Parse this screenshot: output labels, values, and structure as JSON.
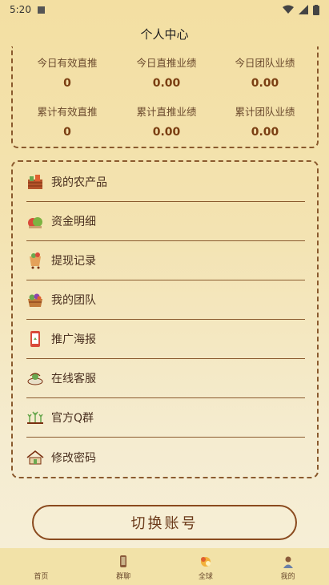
{
  "status_bar": {
    "time": "5:20"
  },
  "header": {
    "title": "个人中心"
  },
  "stats": [
    {
      "label": "今日有效直推",
      "value": "0"
    },
    {
      "label": "今日直推业绩",
      "value": "0.00"
    },
    {
      "label": "今日团队业绩",
      "value": "0.00"
    },
    {
      "label": "累计有效直推",
      "value": "0"
    },
    {
      "label": "累计直推业绩",
      "value": "0.00"
    },
    {
      "label": "累计团队业绩",
      "value": "0.00"
    }
  ],
  "menu": {
    "items": [
      {
        "label": "我的农产品",
        "icon": "farm-produce-icon"
      },
      {
        "label": "资金明细",
        "icon": "funds-icon"
      },
      {
        "label": "提现记录",
        "icon": "withdraw-icon"
      },
      {
        "label": "我的团队",
        "icon": "team-icon"
      },
      {
        "label": "推广海报",
        "icon": "poster-icon"
      },
      {
        "label": "在线客服",
        "icon": "customer-service-icon"
      },
      {
        "label": "官方Q群",
        "icon": "qq-group-icon"
      },
      {
        "label": "修改密码",
        "icon": "password-icon"
      }
    ]
  },
  "switch_account": {
    "label": "切换账号"
  },
  "tabs": [
    {
      "label": "首页",
      "icon": "home-icon"
    },
    {
      "label": "群聊",
      "icon": "chat-icon"
    },
    {
      "label": "全球",
      "icon": "global-icon"
    },
    {
      "label": "我的",
      "icon": "profile-icon"
    }
  ],
  "colors": {
    "accent": "#7a3e12",
    "border": "#8a5a2e",
    "background": "#f3e3b2"
  }
}
